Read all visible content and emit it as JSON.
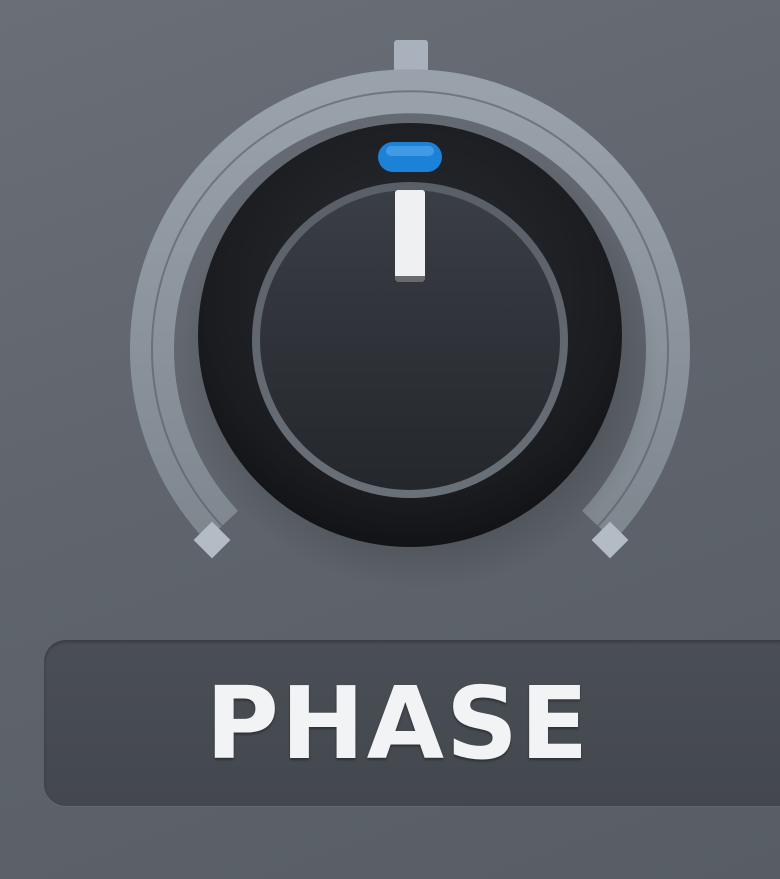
{
  "knob": {
    "label": "PHASE",
    "value_fraction": 0.5,
    "indicator_color": "#1b82d8",
    "icon": "rotary-knob"
  },
  "colors": {
    "background": "#62676f",
    "arc": "#8a929b",
    "knob_face": "#2e3137",
    "label_bg": "#474b52",
    "label_text": "#f2f3f5"
  }
}
